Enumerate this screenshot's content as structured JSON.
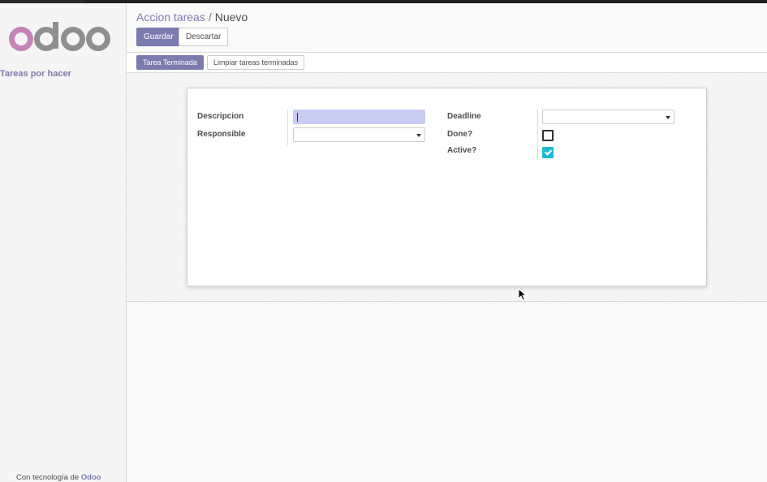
{
  "sidebar": {
    "menu_item": "Tareas por hacer",
    "powered_prefix": "Con tecnología de",
    "powered_brand": "Odoo"
  },
  "breadcrumb": {
    "parent": "Accion tareas",
    "separator": "/",
    "current": "Nuevo"
  },
  "toolbar": {
    "save_label": "Guardar",
    "discard_label": "Descartar"
  },
  "header": {
    "done_task_label": "Tarea Terminada",
    "clear_done_label": "Limpiar tareas terminadas"
  },
  "form": {
    "description_label": "Descripcion",
    "description_value": "",
    "responsible_label": "Responsible",
    "responsible_value": "",
    "deadline_label": "Deadline",
    "deadline_value": "",
    "done_label": "Done?",
    "done_checked": false,
    "active_label": "Active?",
    "active_checked": true
  },
  "colors": {
    "brand_primary": "#7c7bad",
    "logo_o": "#c583b6",
    "logo_doo": "#8f8f8f",
    "checkbox_checked": "#20b8d6",
    "focus_input": "#c9ccf2"
  },
  "icons": {
    "logo": "odoo-logo",
    "select": "caret-down-icon",
    "check": "checkmark-icon",
    "cursor": "mouse-pointer-icon"
  }
}
